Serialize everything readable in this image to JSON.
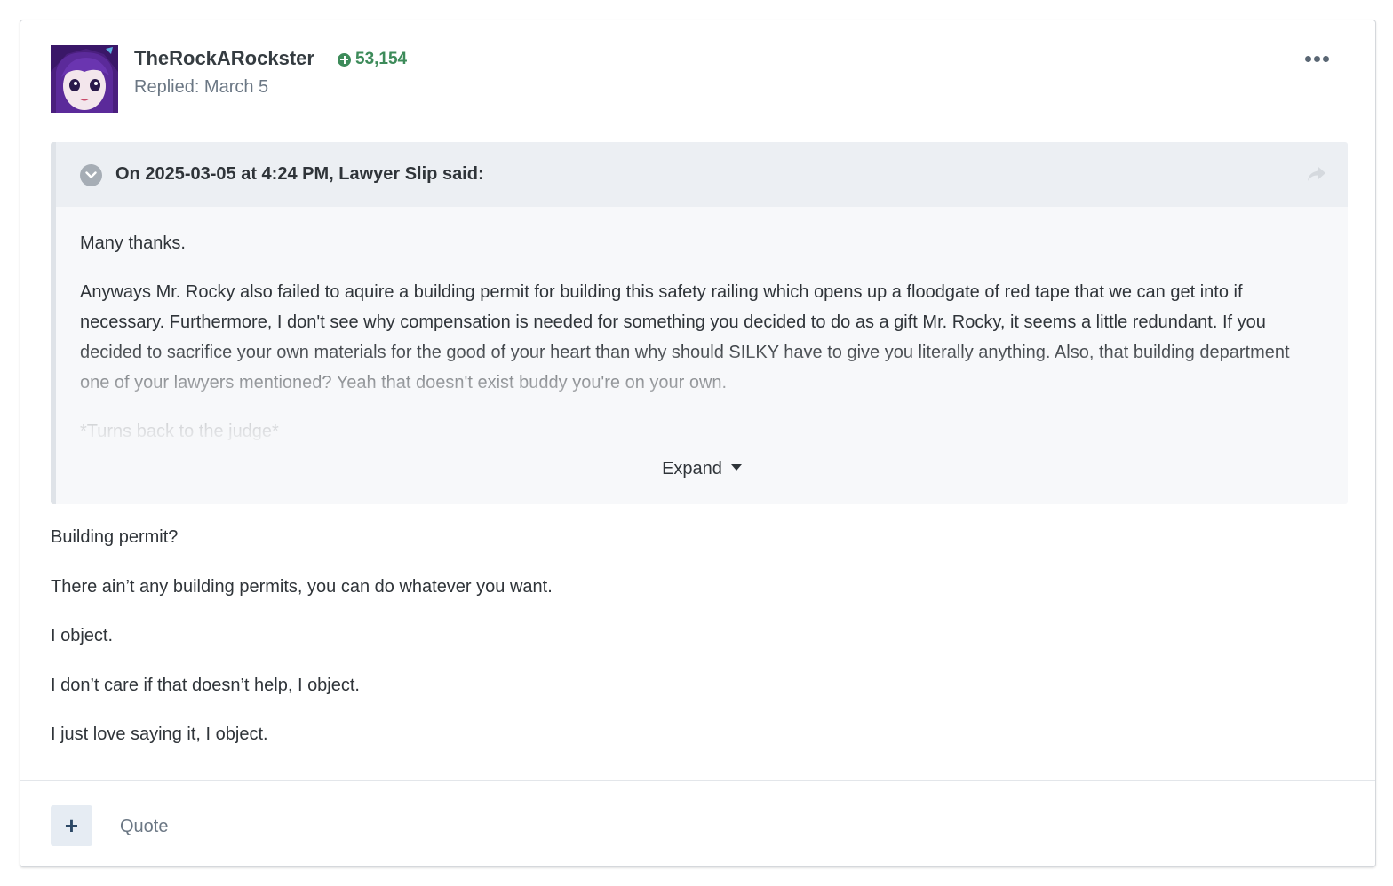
{
  "author": {
    "name": "TheRockARockster",
    "reputation": "53,154",
    "replied": "Replied: March 5"
  },
  "quote": {
    "citation": "On 2025-03-05 at 4:24 PM, Lawyer Slip said:",
    "paragraphs": [
      "Many thanks.",
      "Anyways Mr. Rocky also failed to aquire a building permit for building this safety railing which opens up a floodgate of red tape that we can get into if necessary. Furthermore, I don't see why compensation is needed for something you decided to do as a gift Mr. Rocky, it seems a little redundant. If you decided to sacrifice your own materials for the good of your heart than why should SILKY have to give you literally anything. Also, that building department one of your lawyers mentioned? Yeah that doesn't exist buddy you're on your own.",
      "*Turns back to the judge*"
    ],
    "expand_label": "Expand"
  },
  "body": {
    "paragraphs": [
      "Building permit?",
      "There ain’t any building permits, you can do whatever you want.",
      "I object.",
      "I don’t care if that doesn’t help, I object.",
      "I just love saying it, I object."
    ]
  },
  "footer": {
    "plus_label": "+",
    "quote_label": "Quote"
  },
  "colors": {
    "reputation": "#3d8b5a",
    "quote_header_bg": "#eceff3",
    "quote_bg": "#f7f8fa",
    "plus_button_bg": "#e6ecf3"
  }
}
